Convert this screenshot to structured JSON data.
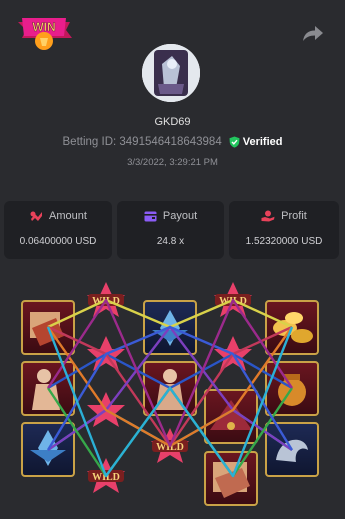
{
  "logo": {
    "text": "WIN"
  },
  "user": {
    "name": "GKD69"
  },
  "betting": {
    "id_label": "Betting ID: 3491546418643984",
    "verified_label": "Verified",
    "datetime": "3/3/2022, 3:29:21 PM"
  },
  "stats": {
    "amount": {
      "label": "Amount",
      "value": "0.06400000 USD"
    },
    "payout": {
      "label": "Payout",
      "value": "24.8 x"
    },
    "profit": {
      "label": "Profit",
      "value": "1.52320000 USD"
    }
  },
  "wild_label": "WILD",
  "colors": {
    "background": "#2a2b2f",
    "card": "#1f2024",
    "amount_icon": "#e8425a",
    "payout_icon": "#8b5cf6",
    "profit_icon": "#e8425a",
    "verified": "#22c55e"
  },
  "icons": [
    "share-icon",
    "shield-check-icon",
    "coins-icon",
    "wallet-icon",
    "hand-coin-icon"
  ]
}
